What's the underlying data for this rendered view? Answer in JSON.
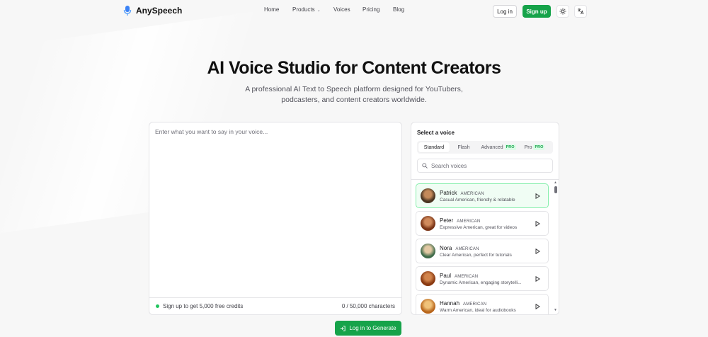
{
  "brand": {
    "name": "AnySpeech"
  },
  "nav": {
    "home": "Home",
    "products": "Products",
    "voices": "Voices",
    "pricing": "Pricing",
    "blog": "Blog",
    "login": "Log in",
    "signup": "Sign up"
  },
  "hero": {
    "title": "AI Voice Studio for Content Creators",
    "subtitle": "A professional AI Text to Speech platform designed for YouTubers, podcasters, and content creators worldwide."
  },
  "editor": {
    "placeholder": "Enter what you want to say in your voice...",
    "promo": "Sign up to get 5,000 free credits",
    "char_count": "0 / 50,000 characters"
  },
  "voice_panel": {
    "title": "Select a voice",
    "tabs": [
      {
        "label": "Standard",
        "active": true
      },
      {
        "label": "Flash"
      },
      {
        "label": "Advanced",
        "badge": "PRO"
      },
      {
        "label": "Pro",
        "badge": "PRO"
      }
    ],
    "search_placeholder": "Search voices",
    "voices": [
      {
        "name": "Patrick",
        "accent": "AMERICAN",
        "desc": "Casual American, friendly & relatable",
        "selected": true,
        "avatar_color": "#4a3522"
      },
      {
        "name": "Peter",
        "accent": "AMERICAN",
        "desc": "Expressive American, great for videos",
        "avatar_color": "#7a3416"
      },
      {
        "name": "Nora",
        "accent": "AMERICAN",
        "desc": "Clear American, perfect for tutorials",
        "avatar_color": "#3f6b4a"
      },
      {
        "name": "Paul",
        "accent": "AMERICAN",
        "desc": "Dynamic American, engaging storytelli...",
        "avatar_color": "#8a3a12"
      },
      {
        "name": "Hannah",
        "accent": "AMERICAN",
        "desc": "Warm American, ideal for audiobooks",
        "avatar_color": "#b8661c"
      }
    ]
  },
  "generate": {
    "label": "Log in to Generate"
  },
  "colors": {
    "accent": "#16a34a",
    "selected_border": "#86efac",
    "selected_bg": "#f0fdf4"
  }
}
